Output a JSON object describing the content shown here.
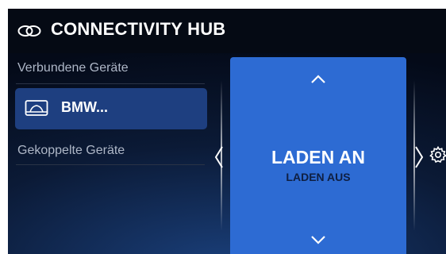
{
  "header": {
    "title": "CONNECTIVITY HUB",
    "icon": "link-icon"
  },
  "sidebar": {
    "connected_label": "Verbundene Geräte",
    "paired_label": "Gekoppelte Geräte",
    "devices": [
      {
        "label": "BMW...",
        "icon": "car-screen-icon",
        "selected": true
      }
    ]
  },
  "panel": {
    "primary": "LADEN AN",
    "secondary": "LADEN AUS",
    "up_icon": "chevron-up-icon",
    "down_icon": "chevron-down-icon"
  },
  "nav": {
    "left_icon": "chevron-left-icon",
    "right_icon": "chevron-right-icon",
    "settings_icon": "gear-icon"
  },
  "colors": {
    "panel": "#2d6bd3",
    "selected_device": "#1e3f80",
    "titlebar": "#050a14",
    "background": "#0b1a36"
  }
}
